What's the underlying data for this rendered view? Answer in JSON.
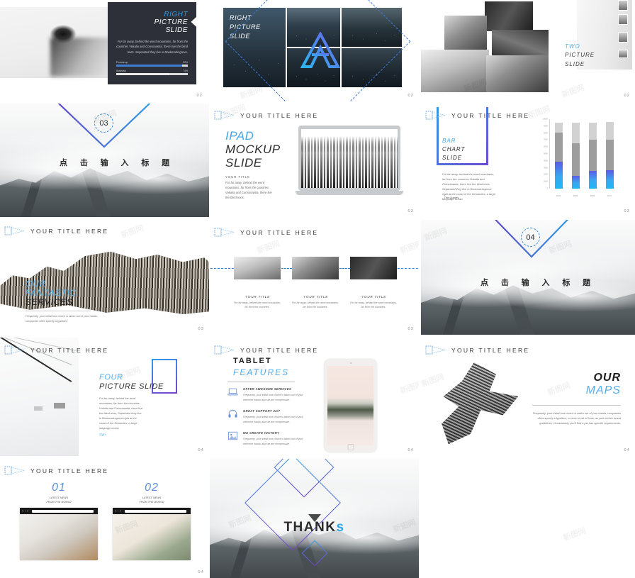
{
  "deck": {
    "watermark": "新图网"
  },
  "slides": [
    {
      "id": "right-picture-slide-dark",
      "page": "02",
      "title_line1": "RIGHT",
      "title_line2": "PICTURE",
      "title_line3": "SLIDE",
      "body": "For far away, behind the word mountains, far from the countries Vokalia and Consonantia, there live the blind texts. Separated they live in Bookmarksgrove.",
      "bars": [
        {
          "label": "Photoshop",
          "value": "92%",
          "percent": 92
        },
        {
          "label": "Illustrator",
          "value": "74%",
          "percent": 74
        }
      ]
    },
    {
      "id": "right-picture-slide-grid",
      "page": "02",
      "title_line1": "RIGHT",
      "title_line2": "PICTURE",
      "title_line3": "SLIDE"
    },
    {
      "id": "two-picture-slide",
      "page": "02",
      "title_line1": "TWO",
      "title_line2": "PICTURE",
      "title_line3": "SLIDE"
    },
    {
      "id": "section-break-03",
      "page": "",
      "number": "03",
      "title": "点 击 输 入 标 题"
    },
    {
      "id": "ipad-mockup-slide",
      "page": "03",
      "header": "YOUR TITLE HERE",
      "title_line1": "IPAD",
      "title_line2": "MOCKUP",
      "title_line3": "SLIDE",
      "sub": "YOUR TITLE",
      "body": "For far away, behind the word mountains, far from the countries Vokalia and Consonantia, there live the blind texts."
    },
    {
      "id": "bar-chart-slide",
      "page": "03",
      "header": "YOUR TITLE HERE",
      "title_line1": "BAR",
      "title_line2": "CHART",
      "title_line3": "SLIDE",
      "body": "For far away, behind the word mountains, far from the countries Vokalia and Consonantia, there live the blind texts. Separated they live in Bookmarksgrove right at the coast of the Semantics, a large language ocean.",
      "quote": "- The Quotes"
    },
    {
      "id": "our-fantastic-services",
      "page": "03",
      "header": "YOUR TITLE HERE",
      "title_line1": "OUR",
      "title_line2": "FANTASTIC",
      "title_line3": "SERVICES",
      "body": "Frequently, your initial font choice is taken out of your hands; companies often specify a typeface."
    },
    {
      "id": "three-picture-timeline",
      "page": "03",
      "header": "YOUR TITLE HERE",
      "cards": [
        {
          "title": "YOUR TITLE",
          "body": "For far away, behind the word mountains, far from the countries."
        },
        {
          "title": "YOUR TITLE",
          "body": "For far away, behind the word mountains, far from the countries."
        },
        {
          "title": "YOUR TITLE",
          "body": "For far away, behind the word mountains, far from the countries."
        }
      ]
    },
    {
      "id": "section-break-04",
      "page": "",
      "number": "04",
      "title": "点 击 输 入 标 题"
    },
    {
      "id": "four-picture-slide",
      "page": "04",
      "header": "YOUR TITLE HERE",
      "title_line1": "FOUR",
      "title_line2": "PICTURE SLIDE",
      "body": "For far away, behind the word mountains, far from the countries Vokalia and Consonantia, there live the blind texts. Separated they live in Bookmarksgrove right at the coast of the Semantics, a large language ocean.",
      "more": "Sign"
    },
    {
      "id": "tablet-features-slide",
      "page": "04",
      "header": "YOUR TITLE HERE",
      "title_line1": "TABLET",
      "title_line2": "FEATURES",
      "features": [
        {
          "icon": "laptop-icon",
          "title": "OFFER AWESOME SERVICES",
          "body": "Frequently, your initial font choice is taken out of your welcome hands also we are compensate."
        },
        {
          "icon": "headphones-icon",
          "title": "GREAT SUPPORT 24/7",
          "body": "Frequently, your initial font choice is taken out of your welcome hands also we are compensate."
        },
        {
          "icon": "photo-icon",
          "title": "WE CREATE HISTORY",
          "body": "Frequently, your initial font choice is taken out of your welcome hands also we are compensate."
        }
      ]
    },
    {
      "id": "our-maps-slide",
      "page": "04",
      "header": "YOUR TITLE HERE",
      "title_line1": "OUR",
      "title_line2": "MAPS",
      "body": "Frequently, your initial font choice is taken out of your hands; companies often specify a typeface, or even a set of fonts, as part of their brand guidelines. Occasionally you'll find a job has specific requirements."
    },
    {
      "id": "latest-news-slide",
      "page": "04",
      "header": "YOUR TITLE HERE",
      "items": [
        {
          "number": "01",
          "caption_line1": "LATEST NEWS",
          "caption_line2": "FROM THE WORLD"
        },
        {
          "number": "02",
          "caption_line1": "LATEST NEWS",
          "caption_line2": "FROM THE WORLD"
        }
      ]
    },
    {
      "id": "thanks-slide",
      "page": "",
      "title": "THANK",
      "title_accent": "s"
    }
  ],
  "chart_data": {
    "type": "bar",
    "stacked": true,
    "title": "",
    "xlabel": "",
    "ylabel": "",
    "categories": [
      "2004",
      "2005",
      "2006",
      "2007"
    ],
    "ylim": [
      0,
      10000
    ],
    "yticks": [
      "10000",
      "9000",
      "8000",
      "7000",
      "6000",
      "5000",
      "4000",
      "3000",
      "2000",
      "1000",
      "0"
    ],
    "grid": false,
    "legend": "none",
    "series": [
      {
        "name": "Series 1",
        "color": "#3aa8ee",
        "values": [
          3900,
          1800,
          2600,
          2700
        ]
      },
      {
        "name": "Series 2",
        "color": "#9d9d9d",
        "values": [
          4200,
          4700,
          4400,
          4300
        ]
      },
      {
        "name": "Series 3",
        "color": "#d2d2d2",
        "values": [
          1400,
          3000,
          2500,
          2600
        ]
      }
    ]
  }
}
